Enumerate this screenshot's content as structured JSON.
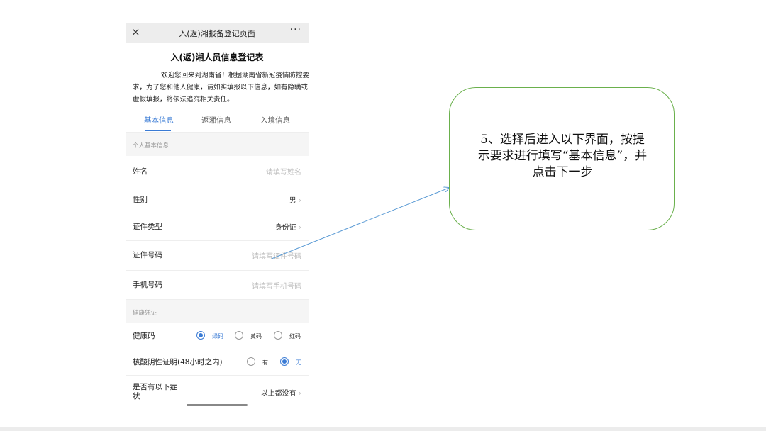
{
  "phone": {
    "nav": {
      "close_icon": "×",
      "title": "入(返)湘报备登记页面",
      "more_icon": "···"
    },
    "form_title": "入(返)湘人员信息登记表",
    "intro": "欢迎您回来到湖南省！根据湖南省新冠疫情防控要求，为了您和他人健康，请如实填报以下信息，如有隐瞒或虚假填报，将依法追究相关责任。",
    "tabs": [
      {
        "label": "基本信息",
        "active": true
      },
      {
        "label": "返湘信息",
        "active": false
      },
      {
        "label": "入境信息",
        "active": false
      }
    ],
    "section_personal": "个人基本信息",
    "fields": {
      "name": {
        "label": "姓名",
        "placeholder": "请填写姓名"
      },
      "gender": {
        "label": "性别",
        "value": "男"
      },
      "id_type": {
        "label": "证件类型",
        "value": "身份证"
      },
      "id_number": {
        "label": "证件号码",
        "placeholder": "请填写证件号码"
      },
      "phone": {
        "label": "手机号码",
        "placeholder": "请填写手机号码"
      }
    },
    "section_health": "健康凭证",
    "health_code": {
      "label": "健康码",
      "options": [
        {
          "label": "绿码",
          "checked": true
        },
        {
          "label": "黄码",
          "checked": false
        },
        {
          "label": "红码",
          "checked": false
        }
      ]
    },
    "nucleic": {
      "label": "核酸阴性证明(48小时之内)",
      "options": [
        {
          "label": "有",
          "checked": false
        },
        {
          "label": "无",
          "checked": true
        }
      ]
    },
    "symptoms": {
      "label_line1": "是否有以下症",
      "label_line2": "状",
      "value": "以上都没有"
    },
    "chevron": "›"
  },
  "callout": {
    "line1": "5、选择后进入以下界面，按提",
    "line2": "示要求进行填写“基本信息”，并",
    "line3": "点击下一步"
  },
  "colors": {
    "accent": "#3a7bd5",
    "callout_border": "#6ab04c",
    "arrow": "#5b9bd5"
  }
}
